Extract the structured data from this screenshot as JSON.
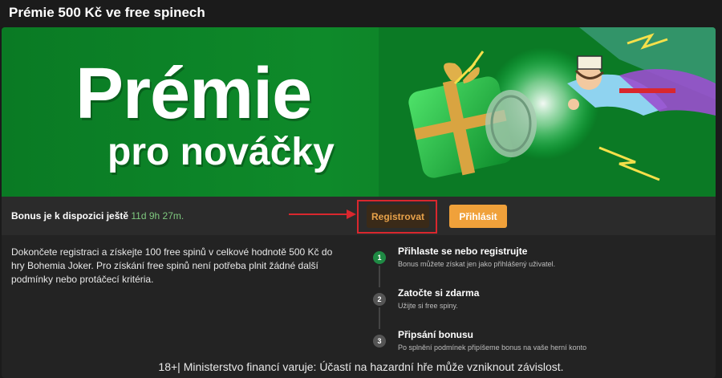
{
  "page": {
    "title": "Prémie 500 Kč ve free spinech"
  },
  "banner": {
    "headline": "Prémie",
    "subheadline": "pro nováčky"
  },
  "bar": {
    "bonus_label": "Bonus je k dispozici ještě",
    "bonus_time": "11d 9h 27m.",
    "register_label": "Registrovat",
    "login_label": "Přihlásit",
    "highlight_color": "#d9272e",
    "login_color": "#f0a13a"
  },
  "description": "Dokončete registraci a získejte 100 free spinů v celkové hodnotě 500 Kč do hry Bohemia Joker. Pro získání free spinů není potřeba plnit žádné další podmínky nebo protáčecí kritéria.",
  "steps": [
    {
      "number": "1",
      "title": "Přihlaste se nebo registrujte",
      "subtitle": "Bonus můžete získat jen jako přihlášený uživatel.",
      "status": "active"
    },
    {
      "number": "2",
      "title": "Zatočte si zdarma",
      "subtitle": "Užijte si free spiny.",
      "status": "pending"
    },
    {
      "number": "3",
      "title": "Připsání bonusu",
      "subtitle": "Po splnění podmínek připíšeme bonus na vaše herní konto",
      "status": "pending"
    }
  ],
  "footer": {
    "warning": "18+| Ministerstvo financí varuje: Účastí na hazardní hře může vzniknout závislost."
  }
}
